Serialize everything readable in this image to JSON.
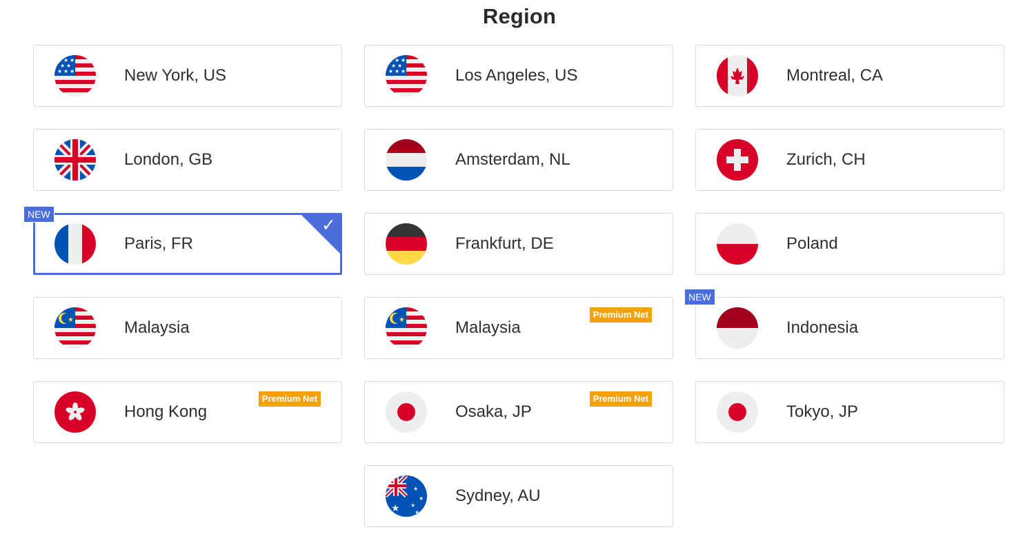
{
  "page": {
    "title": "Region"
  },
  "badges": {
    "new": "NEW",
    "premium": "Premium Net",
    "selected_mark": "✓"
  },
  "regions": [
    {
      "label": "New York, US",
      "flag": "us-flag-icon"
    },
    {
      "label": "Los Angeles, US",
      "flag": "us-flag-icon"
    },
    {
      "label": "Montreal, CA",
      "flag": "ca-flag-icon"
    },
    {
      "label": "London, GB",
      "flag": "gb-flag-icon"
    },
    {
      "label": "Amsterdam, NL",
      "flag": "nl-flag-icon"
    },
    {
      "label": "Zurich, CH",
      "flag": "ch-flag-icon"
    },
    {
      "label": "Paris, FR",
      "flag": "fr-flag-icon",
      "selected": true,
      "new": true
    },
    {
      "label": "Frankfurt, DE",
      "flag": "de-flag-icon"
    },
    {
      "label": "Poland",
      "flag": "pl-flag-icon"
    },
    {
      "label": "Malaysia",
      "flag": "my-flag-icon"
    },
    {
      "label": "Malaysia",
      "flag": "my-flag-icon",
      "premium": true
    },
    {
      "label": "Indonesia",
      "flag": "id-flag-icon",
      "new": true
    },
    {
      "label": "Hong Kong",
      "flag": "hk-flag-icon",
      "premium": true
    },
    {
      "label": "Osaka, JP",
      "flag": "jp-flag-icon",
      "premium": true
    },
    {
      "label": "Tokyo, JP",
      "flag": "jp-flag-icon"
    },
    {
      "label": "Sydney, AU",
      "flag": "au-flag-icon"
    }
  ],
  "colors": {
    "accent": "#4a6fdc",
    "premium": "#f5a20a",
    "border": "#d9d9d9"
  }
}
